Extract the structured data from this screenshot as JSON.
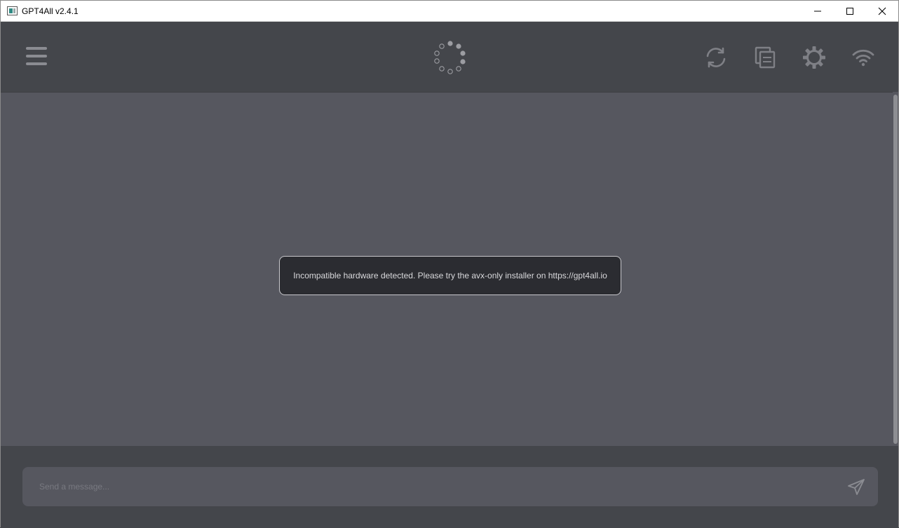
{
  "window": {
    "title": "GPT4All v2.4.1"
  },
  "header": {
    "menu_icon": "hamburger-menu-icon",
    "loading_icon": "loading-spinner-icon",
    "actions": [
      {
        "name": "regenerate",
        "icon": "refresh-icon"
      },
      {
        "name": "copy-conversation",
        "icon": "copy-icon"
      },
      {
        "name": "settings",
        "icon": "gear-icon"
      },
      {
        "name": "network",
        "icon": "wifi-icon"
      }
    ]
  },
  "chat": {
    "error_message": "Incompatible hardware detected. Please try the avx-only installer on https://gpt4all.io"
  },
  "input": {
    "placeholder": "Send a message...",
    "value": "",
    "send_icon": "send-icon"
  },
  "colors": {
    "background": "#44464b",
    "chat_background": "#56575f",
    "toast_background": "#2b2c31",
    "icon_color": "#8b8c92"
  }
}
